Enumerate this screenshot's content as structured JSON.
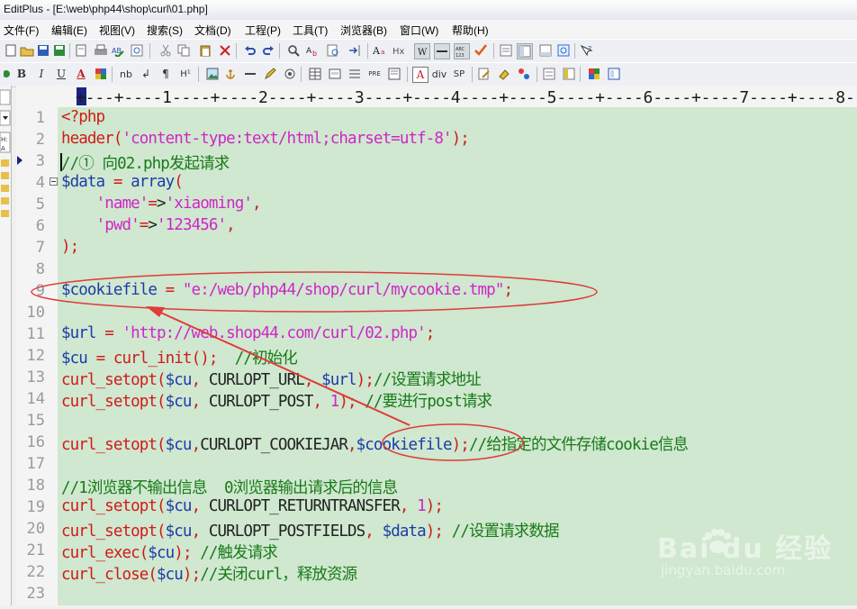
{
  "window": {
    "title": "EditPlus - [E:\\web\\php44\\shop\\curl\\01.php]"
  },
  "menu": [
    {
      "label": "文件(F)"
    },
    {
      "label": "编辑(E)"
    },
    {
      "label": "视图(V)"
    },
    {
      "label": "搜索(S)"
    },
    {
      "label": "文档(D)"
    },
    {
      "label": "工程(P)"
    },
    {
      "label": "工具(T)"
    },
    {
      "label": "浏览器(B)"
    },
    {
      "label": "窗口(W)"
    },
    {
      "label": "帮助(H)"
    }
  ],
  "toolbar_html": [
    "B",
    "I",
    "U",
    "A",
    "nb",
    "↲",
    "¶",
    "H¹",
    "PRE",
    "A",
    "div",
    "SP"
  ],
  "ruler": "+---+----1----+----2----+----3----+----4----+----5----+----6----+----7----+----8-",
  "editor": {
    "lines": [
      {
        "n": "1",
        "text": "<?php"
      },
      {
        "n": "2",
        "text": "header('content-type:text/html;charset=utf-8');"
      },
      {
        "n": "3",
        "text": "//① 向02.php发起请求"
      },
      {
        "n": "4",
        "text": "$data = array("
      },
      {
        "n": "5",
        "text": "    'name'=>'xiaoming',"
      },
      {
        "n": "6",
        "text": "    'pwd'=>'123456',"
      },
      {
        "n": "7",
        "text": ");"
      },
      {
        "n": "8",
        "text": ""
      },
      {
        "n": "9",
        "text": "$cookiefile = \"e:/web/php44/shop/curl/mycookie.tmp\";"
      },
      {
        "n": "10",
        "text": ""
      },
      {
        "n": "11",
        "text": "$url = 'http://web.shop44.com/curl/02.php';"
      },
      {
        "n": "12",
        "text": "$cu = curl_init();  //初始化"
      },
      {
        "n": "13",
        "text": "curl_setopt($cu, CURLOPT_URL, $url);//设置请求地址"
      },
      {
        "n": "14",
        "text": "curl_setopt($cu, CURLOPT_POST, 1); //要进行post请求"
      },
      {
        "n": "15",
        "text": ""
      },
      {
        "n": "16",
        "text": "curl_setopt($cu,CURLOPT_COOKIEJAR,$cookiefile);//给指定的文件存储cookie信息"
      },
      {
        "n": "17",
        "text": ""
      },
      {
        "n": "18",
        "text": "//1浏览器不输出信息  0浏览器输出请求后的信息"
      },
      {
        "n": "19",
        "text": "curl_setopt($cu, CURLOPT_RETURNTRANSFER, 1);"
      },
      {
        "n": "20",
        "text": "curl_setopt($cu, CURLOPT_POSTFIELDS, $data); //设置请求数据"
      },
      {
        "n": "21",
        "text": "curl_exec($cu); //触发请求"
      },
      {
        "n": "22",
        "text": "curl_close($cu);//关闭curl，释放资源"
      },
      {
        "n": "23",
        "text": ""
      }
    ]
  },
  "watermark": {
    "brand": "Bai du 经验",
    "url": "jingyan.baidu.com"
  },
  "colors": {
    "editor_bg": "#cfe8cf",
    "annotation": "#e03a3a"
  }
}
